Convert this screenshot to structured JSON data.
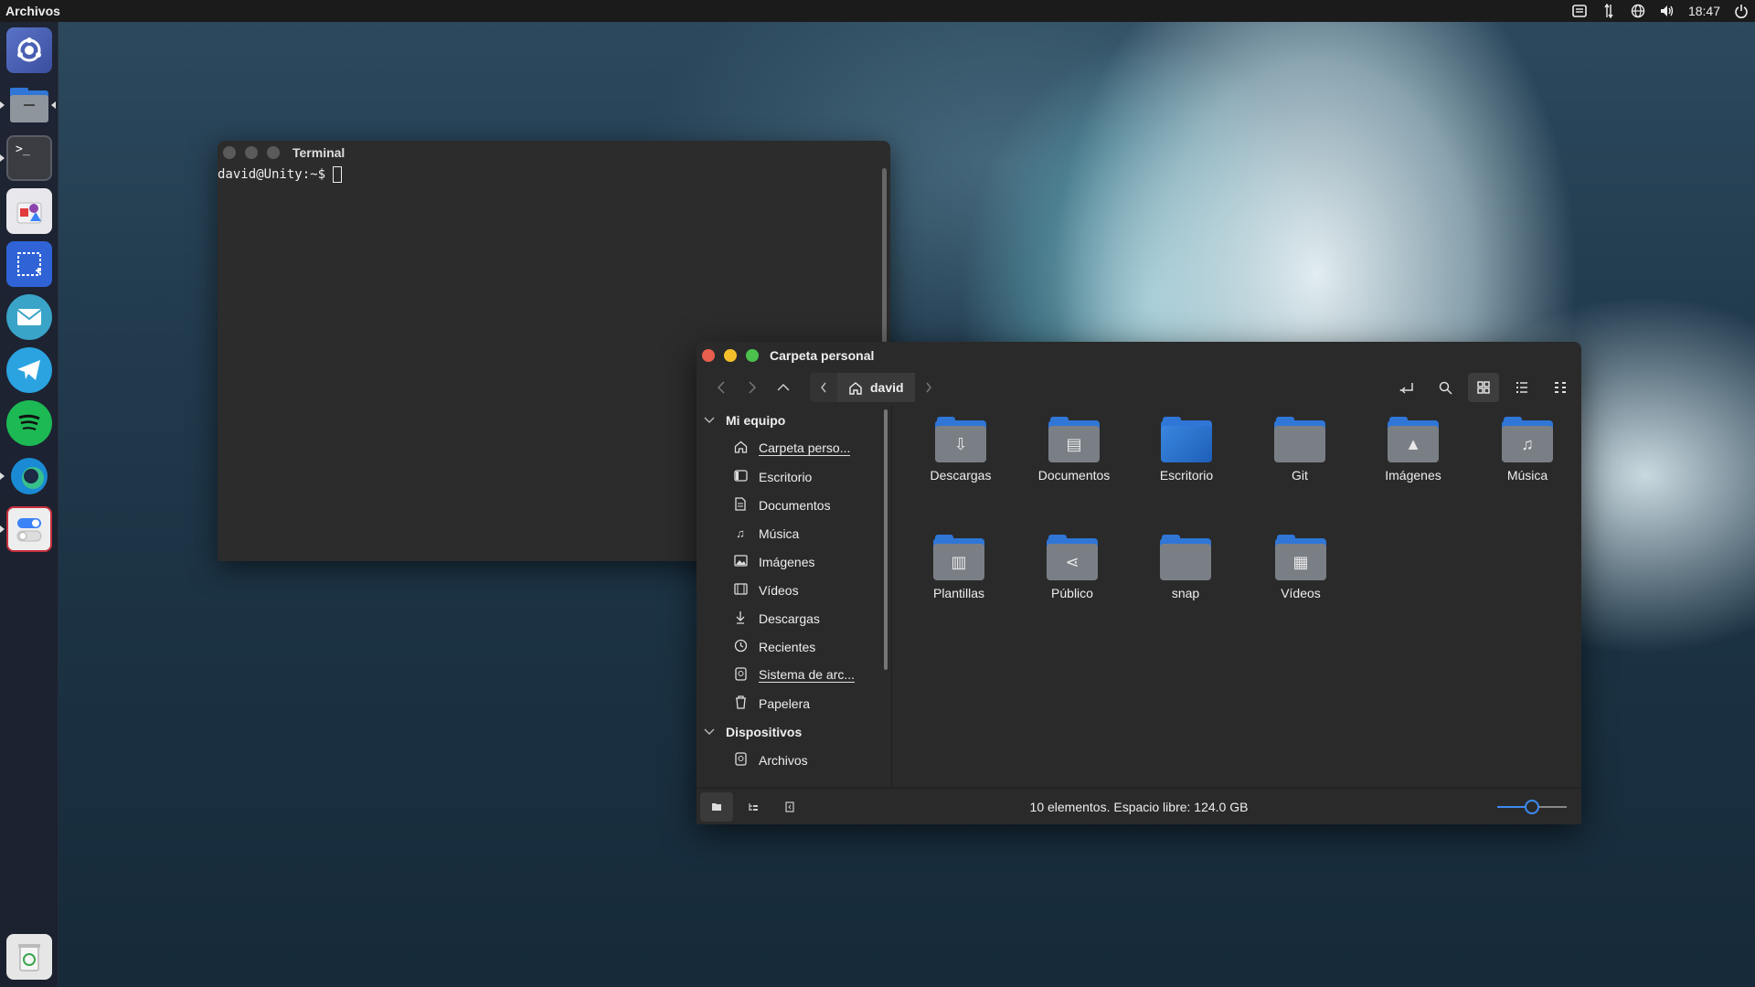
{
  "topbar": {
    "app_title": "Archivos",
    "clock": "18:47",
    "indicators": [
      "messages-icon",
      "network-icon",
      "globe-icon",
      "volume-icon",
      "power-icon"
    ]
  },
  "launcher": {
    "apps": [
      "unity-home",
      "files",
      "terminal",
      "software-center",
      "screenshot",
      "mail",
      "telegram",
      "spotify",
      "edge",
      "settings"
    ],
    "trash": "trash-icon"
  },
  "terminal": {
    "title": "Terminal",
    "prompt": "david@Unity:~$"
  },
  "files": {
    "title": "Carpeta personal",
    "path": "david",
    "sidebar": {
      "sections": [
        {
          "label": "Mi equipo",
          "items": [
            {
              "label": "Carpeta perso...",
              "icon": "home-icon"
            },
            {
              "label": "Escritorio",
              "icon": "desktop-icon"
            },
            {
              "label": "Documentos",
              "icon": "document-icon"
            },
            {
              "label": "Música",
              "icon": "music-icon"
            },
            {
              "label": "Imágenes",
              "icon": "image-icon"
            },
            {
              "label": "Vídeos",
              "icon": "video-icon"
            },
            {
              "label": "Descargas",
              "icon": "download-icon"
            },
            {
              "label": "Recientes",
              "icon": "clock-icon"
            },
            {
              "label": "Sistema de arc...",
              "icon": "drive-icon"
            },
            {
              "label": "Papelera",
              "icon": "trash-icon"
            }
          ]
        },
        {
          "label": "Dispositivos",
          "items": [
            {
              "label": "Archivos",
              "icon": "drive-icon"
            }
          ]
        }
      ]
    },
    "folders": [
      {
        "name": "Descargas",
        "icon": "download-icon"
      },
      {
        "name": "Documentos",
        "icon": "document-icon"
      },
      {
        "name": "Escritorio",
        "icon": "desktop-icon"
      },
      {
        "name": "Git",
        "icon": "folder-icon"
      },
      {
        "name": "Imágenes",
        "icon": "image-icon"
      },
      {
        "name": "Música",
        "icon": "music-icon"
      },
      {
        "name": "Plantillas",
        "icon": "template-icon"
      },
      {
        "name": "Público",
        "icon": "share-icon"
      },
      {
        "name": "snap",
        "icon": "folder-icon"
      },
      {
        "name": "Vídeos",
        "icon": "video-icon"
      }
    ],
    "status": "10 elementos. Espacio libre: 124.0 GB",
    "zoom_level": 0.5
  },
  "colors": {
    "accent": "#3d8af0",
    "folder_blue": "#2f76d6",
    "close": "#e95f4e",
    "minimize": "#f4bf2b",
    "maximize": "#4cc14d"
  }
}
